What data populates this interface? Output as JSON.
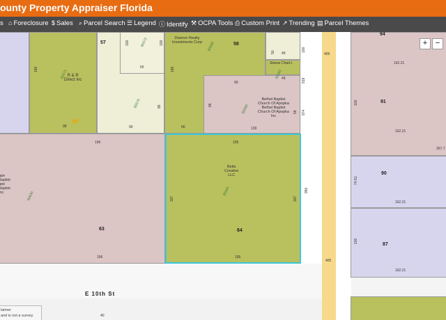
{
  "header": {
    "title": "ounty Property Appraiser Florida",
    "color": "#e86c12"
  },
  "toolbar": {
    "items": [
      {
        "label": "s",
        "icon": "unknown-icon"
      },
      {
        "label": "Foreclosure",
        "icon": "foreclosure-icon"
      },
      {
        "label": "Sales",
        "icon": "dollar-icon"
      },
      {
        "label": "Parcel Search",
        "icon": "search-icon"
      },
      {
        "label": "Legend",
        "icon": "legend-icon"
      },
      {
        "label": "Identify",
        "icon": "info-icon"
      },
      {
        "label": "OCPA Tools",
        "icon": "wrench-icon"
      },
      {
        "label": "Custom Print",
        "icon": "print-icon"
      },
      {
        "label": "Trending",
        "icon": "trending-icon"
      },
      {
        "label": "Parcel Themes",
        "icon": "themes-icon"
      }
    ]
  },
  "map": {
    "parcels": {
      "p57": "57",
      "p58": "58",
      "p63": "63",
      "p64": "64",
      "p90": "90",
      "p91": "91",
      "p87": "87",
      "p94": "94",
      "owner_rr": "R & R\nDirect Inc",
      "owner_diamon": "Diamon Realty\nInvestments Corp",
      "owner_steese": "Steese Chad L",
      "owner_bethel": "Bethel Baptist\nChurch Of Apopka\nBethel Baptist\nChurch Of Apopka\nInc",
      "owner_betts": "Betts\nCreative\nLLC",
      "owner_left": "ope\n Baptist\nope\n Baptist\nInc",
      "hmarker": "H"
    },
    "dimensions": {
      "d196a": "196",
      "d196b": "196",
      "d195a": "195",
      "d195b": "195",
      "d139": "139",
      "d90": "90",
      "d98": "98",
      "d99": "99",
      "d56": "56",
      "d49a": "49",
      "d49b": "49",
      "d65": "65",
      "d100a": "100",
      "d100b": "100",
      "d186a": "186",
      "d186b": "186",
      "d187a": "187",
      "d187b": "187",
      "d86": "86",
      "d50": "50",
      "d58": "58",
      "d162a": "162.21",
      "d162b": "162.21",
      "d162c": "162.21",
      "d162d": "162.21",
      "d267": "267.7",
      "d7451": "74.51",
      "d100c": "100",
      "d100d": "100",
      "d40": "40",
      "d919": "919",
      "d974": "974",
      "d950": "950",
      "d405a": "405",
      "d405b": "405"
    },
    "codes": {
      "c1": "80571",
      "c2": "80572",
      "c3": "80570",
      "c4": "80569",
      "c5": "80583",
      "c6": "80580",
      "c7": "80565",
      "c8": "80630"
    },
    "street": "E 10th St",
    "zoom_in": "+",
    "zoom_out": "−",
    "disclaimer_line1": "laimer",
    "disclaimer_line2": "and is not a survey."
  }
}
